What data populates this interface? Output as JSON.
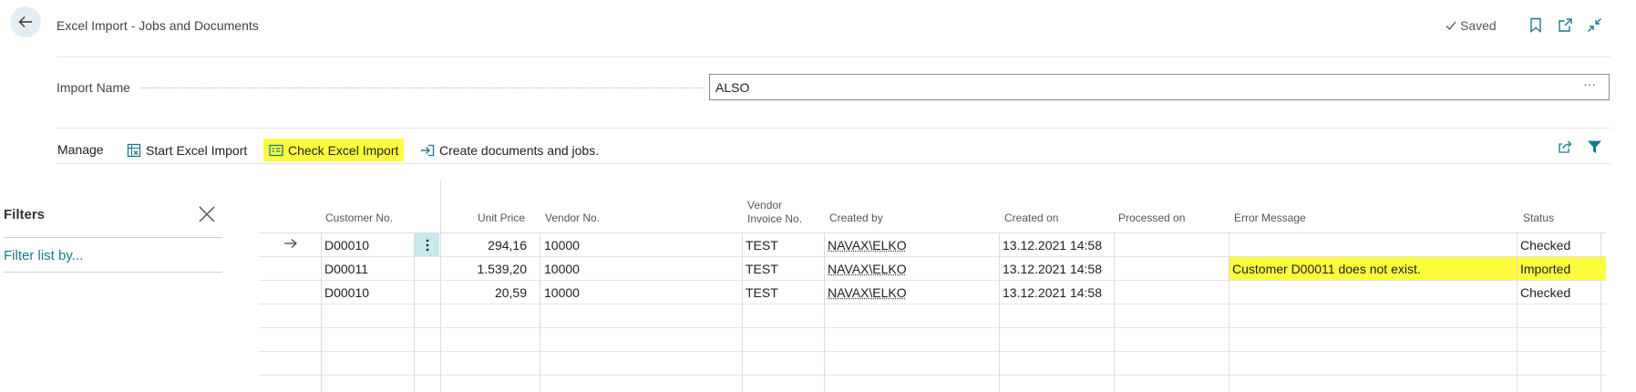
{
  "header": {
    "title": "Excel Import - Jobs and Documents",
    "saved_label": "Saved"
  },
  "field": {
    "label": "Import Name",
    "value": "ALSO",
    "ellipsis": "···"
  },
  "actions": {
    "manage": "Manage",
    "start_import": "Start Excel Import",
    "check_import": "Check Excel Import",
    "create_docs": "Create documents and jobs."
  },
  "filters": {
    "title": "Filters",
    "filter_link": "Filter list by..."
  },
  "columns": {
    "customer_no": "Customer No.",
    "unit_price": "Unit Price",
    "vendor_no": "Vendor No.",
    "vendor_invoice_1": "Vendor",
    "vendor_invoice_2": "Invoice No.",
    "created_by": "Created by",
    "created_on": "Created on",
    "processed_on": "Processed on",
    "error_message": "Error Message",
    "status": "Status"
  },
  "rows": [
    {
      "customer_no": "D00010",
      "unit_price": "294,16",
      "vendor_no": "10000",
      "vendor_invoice": "TEST",
      "created_by": "NAVAX\\ELKO",
      "created_on": "13.12.2021 14:58",
      "processed_on": "",
      "error_message": "",
      "status": "Checked"
    },
    {
      "customer_no": "D00011",
      "unit_price": "1.539,20",
      "vendor_no": "10000",
      "vendor_invoice": "TEST",
      "created_by": "NAVAX\\ELKO",
      "created_on": "13.12.2021 14:58",
      "processed_on": "",
      "error_message": "Customer D00011 does not exist.",
      "status": "Imported"
    },
    {
      "customer_no": "D00010",
      "unit_price": "20,59",
      "vendor_no": "10000",
      "vendor_invoice": "TEST",
      "created_by": "NAVAX\\ELKO",
      "created_on": "13.12.2021 14:58",
      "processed_on": "",
      "error_message": "",
      "status": "Checked"
    }
  ],
  "colors": {
    "accent": "#1a7a8c",
    "highlight": "#fdfd3d",
    "active_cell": "#c8e8ee"
  },
  "icons": {
    "back": "arrow-left-icon",
    "saved": "checkmark-icon",
    "bookmark": "bookmark-icon",
    "open_new": "open-new-window-icon",
    "collapse": "collapse-icon",
    "share": "share-icon",
    "filter": "filter-funnel-icon",
    "close": "close-icon",
    "row_arrow": "arrow-right-icon",
    "row_menu": "more-vertical-icon"
  }
}
